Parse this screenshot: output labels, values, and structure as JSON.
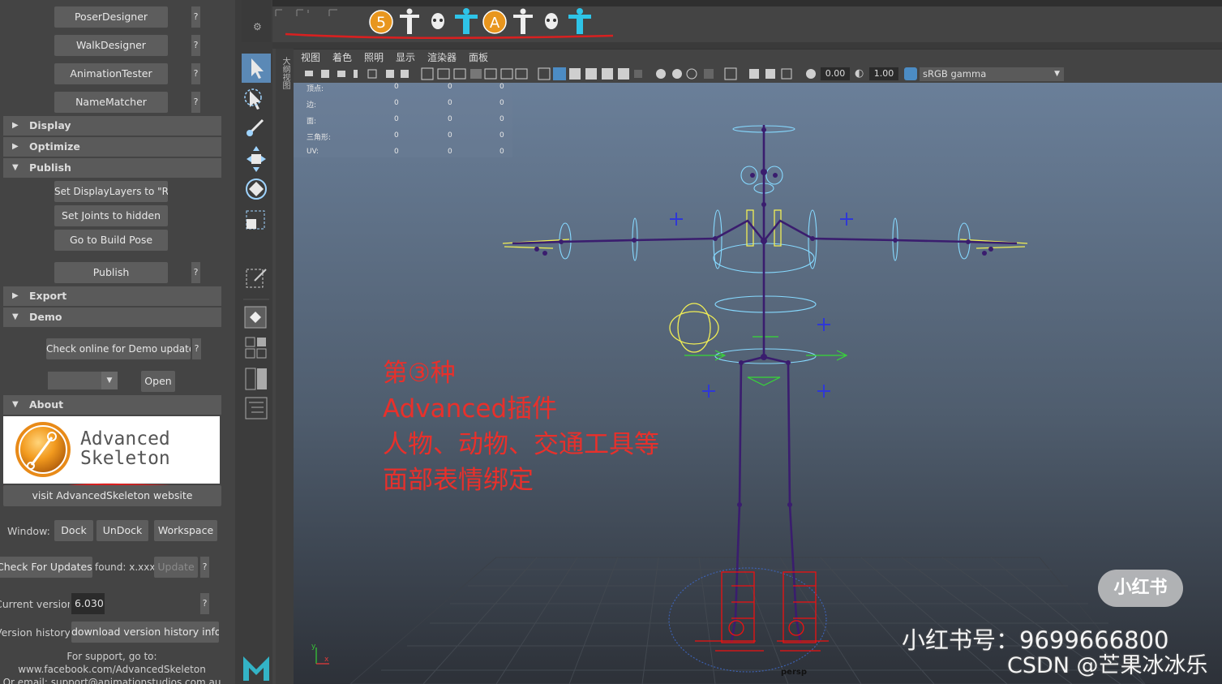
{
  "left_panel": {
    "tool_buttons": [
      {
        "label": "PoserDesigner",
        "help": "?"
      },
      {
        "label": "WalkDesigner",
        "help": "?"
      },
      {
        "label": "AnimationTester",
        "help": "?"
      },
      {
        "label": "NameMatcher",
        "help": "?"
      }
    ],
    "sections": {
      "display": "Display",
      "optimize": "Optimize",
      "publish": "Publish",
      "export": "Export",
      "demo": "Demo",
      "about": "About"
    },
    "publish_buttons": [
      "Set DisplayLayers to \"R\"",
      "Set Joints to hidden",
      "Go to Build Pose"
    ],
    "publish_label": "Publish",
    "publish_help": "?",
    "demo": {
      "check_label": "Check online for Demo update",
      "check_help": "?",
      "dropdown_value": "",
      "open_label": "Open"
    },
    "about": {
      "logo_line1": "Advanced",
      "logo_line2": "Skeleton",
      "website_label": "visit AdvancedSkeleton website",
      "window_label": "Window:",
      "dock_label": "Dock",
      "undock_label": "UnDock",
      "workspace_label": "Workspace",
      "check_updates_label": "Check For Updates",
      "found_label": "found: x.xxx",
      "update_label": "Update",
      "update_help": "?",
      "current_version_label": "Current version",
      "current_version_value": "6.030",
      "current_version_help": "?",
      "version_history_label": "Version history",
      "version_history_button": "download version history info",
      "support_line1": "For support, go to:",
      "support_line2": "www.facebook.com/AdvancedSkeleton",
      "support_line3": "Or email: support@animationstudios.com.au"
    }
  },
  "panel_strip_label": "大纲视图",
  "shelf": {
    "badge_5": "5",
    "badge_a": "A"
  },
  "view_menu": [
    "视图",
    "着色",
    "照明",
    "显示",
    "渲染器",
    "面板"
  ],
  "view_toolbar": {
    "exposure": "0.00",
    "gamma": "1.00",
    "colorspace": "sRGB gamma"
  },
  "hud": {
    "rows": [
      {
        "label": "顶点:",
        "v1": "0",
        "v2": "0",
        "v3": "0"
      },
      {
        "label": "边:",
        "v1": "0",
        "v2": "0",
        "v3": "0"
      },
      {
        "label": "面:",
        "v1": "0",
        "v2": "0",
        "v3": "0"
      },
      {
        "label": "三角形:",
        "v1": "0",
        "v2": "0",
        "v3": "0"
      },
      {
        "label": "UV:",
        "v1": "0",
        "v2": "0",
        "v3": "0"
      }
    ]
  },
  "annotation_lines": [
    "第③种",
    "Advanced插件",
    "人物、动物、交通工具等",
    "面部表情绑定"
  ],
  "camera_label": "persp",
  "axis_y": "y",
  "axis_x": "x",
  "watermark": {
    "badge": "小红书",
    "account": "小红书号：9699666800",
    "csdn": "CSDN @芒果冰冰乐"
  },
  "colors": {
    "annotation_red": "#e8302b",
    "joint": "#3a1d6e",
    "control_cyan": "#7fd8ff",
    "control_yellow": "#f2ef55",
    "foot_red": "#ee1111"
  }
}
